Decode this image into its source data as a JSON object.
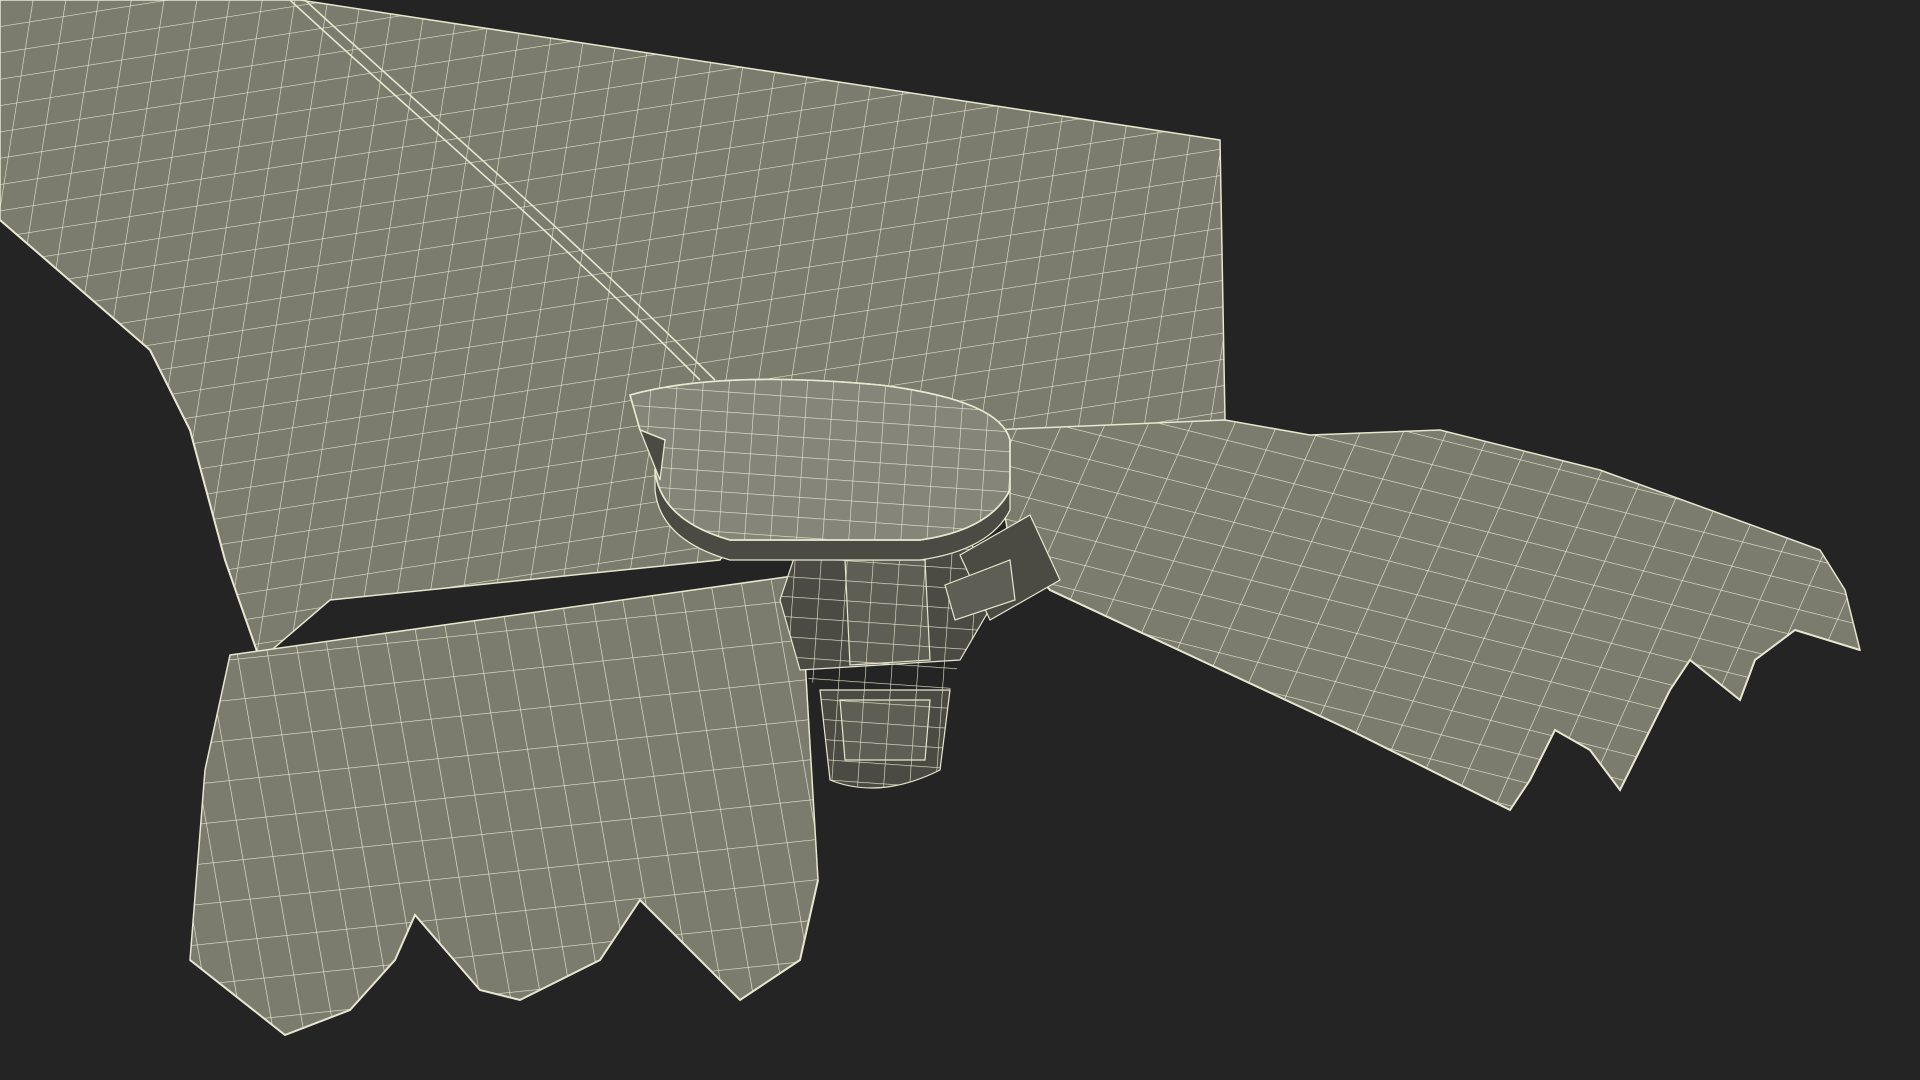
{
  "scene": {
    "subject": "",
    "colors": {
      "background": "#242424",
      "surface": "#7b7b6e",
      "surface_light": "#85857a",
      "surface_dark": "#5e5e54",
      "side_wall": "#4b4b43",
      "wire": "#e8e6cf"
    }
  }
}
